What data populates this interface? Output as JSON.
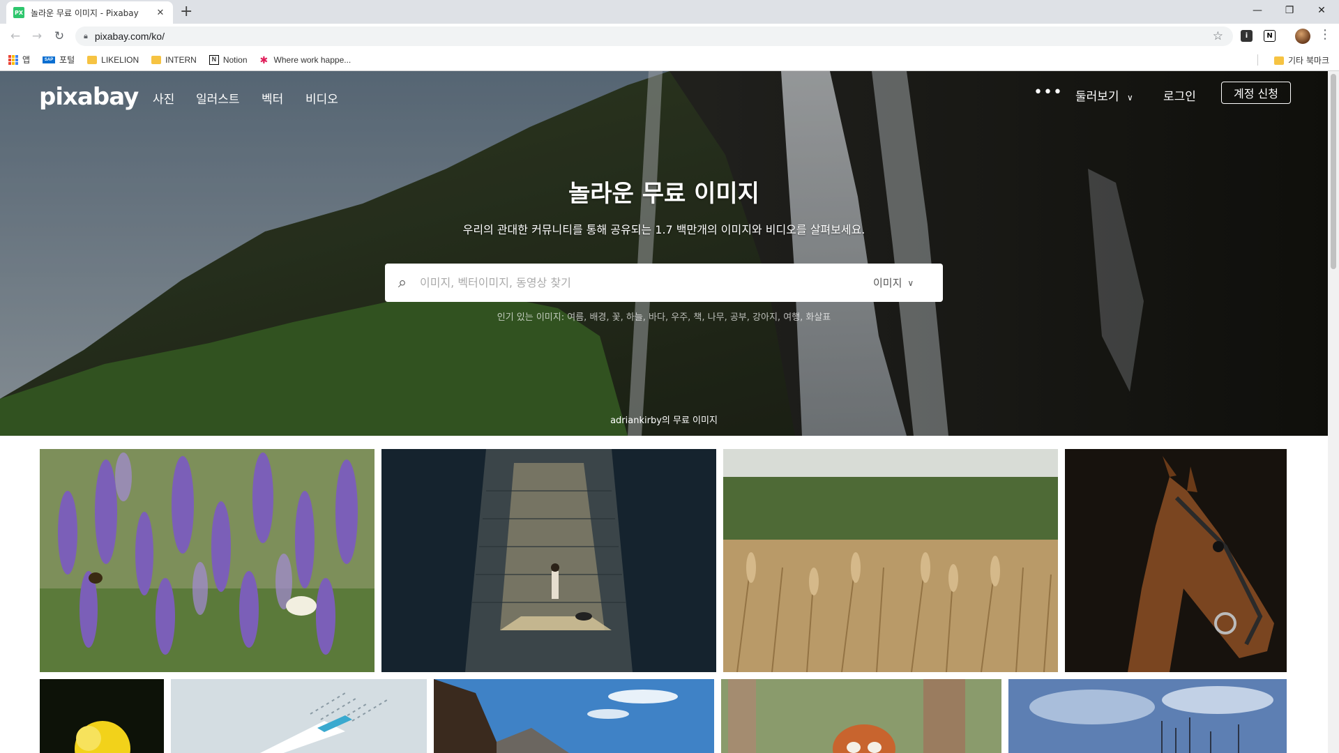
{
  "browser": {
    "tab_title": "놀라운 무료 이미지 - Pixabay",
    "favicon_text": "PX",
    "url": "pixabay.com/ko/",
    "bookmarks": [
      {
        "label": "앱",
        "icon": "apps-icon"
      },
      {
        "label": "포털",
        "icon": "sap-icon"
      },
      {
        "label": "LIKELION",
        "icon": "folder-icon"
      },
      {
        "label": "INTERN",
        "icon": "folder-icon"
      },
      {
        "label": "Notion",
        "icon": "notion-icon"
      },
      {
        "label": "Where work happe...",
        "icon": "slack-icon"
      }
    ],
    "other_bookmarks": "기타 북마크"
  },
  "header": {
    "logo": "pixabay",
    "nav": [
      "사진",
      "일러스트",
      "벡터",
      "비디오"
    ],
    "explore": "둘러보기",
    "login": "로그인",
    "signup": "계정 신청"
  },
  "hero": {
    "title": "놀라운 무료 이미지",
    "subtitle": "우리의 관대한 커뮤니티를 통해 공유되는 1.7 백만개의 이미지와 비디오를 살펴보세요.",
    "search_placeholder": "이미지, 벡터이미지, 동영상 찾기",
    "search_type": "이미지",
    "popular_label": "인기 있는 이미지:",
    "popular_tags": [
      "여름",
      "배경",
      "꽃",
      "하늘",
      "바다",
      "우주",
      "책",
      "나무",
      "공부",
      "강아지",
      "여행",
      "화살표"
    ],
    "credit": "adriankirby의 무료 이미지"
  },
  "grid": {
    "row1": [
      "lavender-photo",
      "staircase-photo",
      "wheat-photo",
      "horse-photo"
    ],
    "row2": [
      "yellow-flower-photo",
      "illustration-photo",
      "mountain-photo",
      "red-panda-photo",
      "harbor-photo"
    ]
  },
  "colors": {
    "accent": "#2ec66d",
    "tabbar": "#dee1e6"
  }
}
